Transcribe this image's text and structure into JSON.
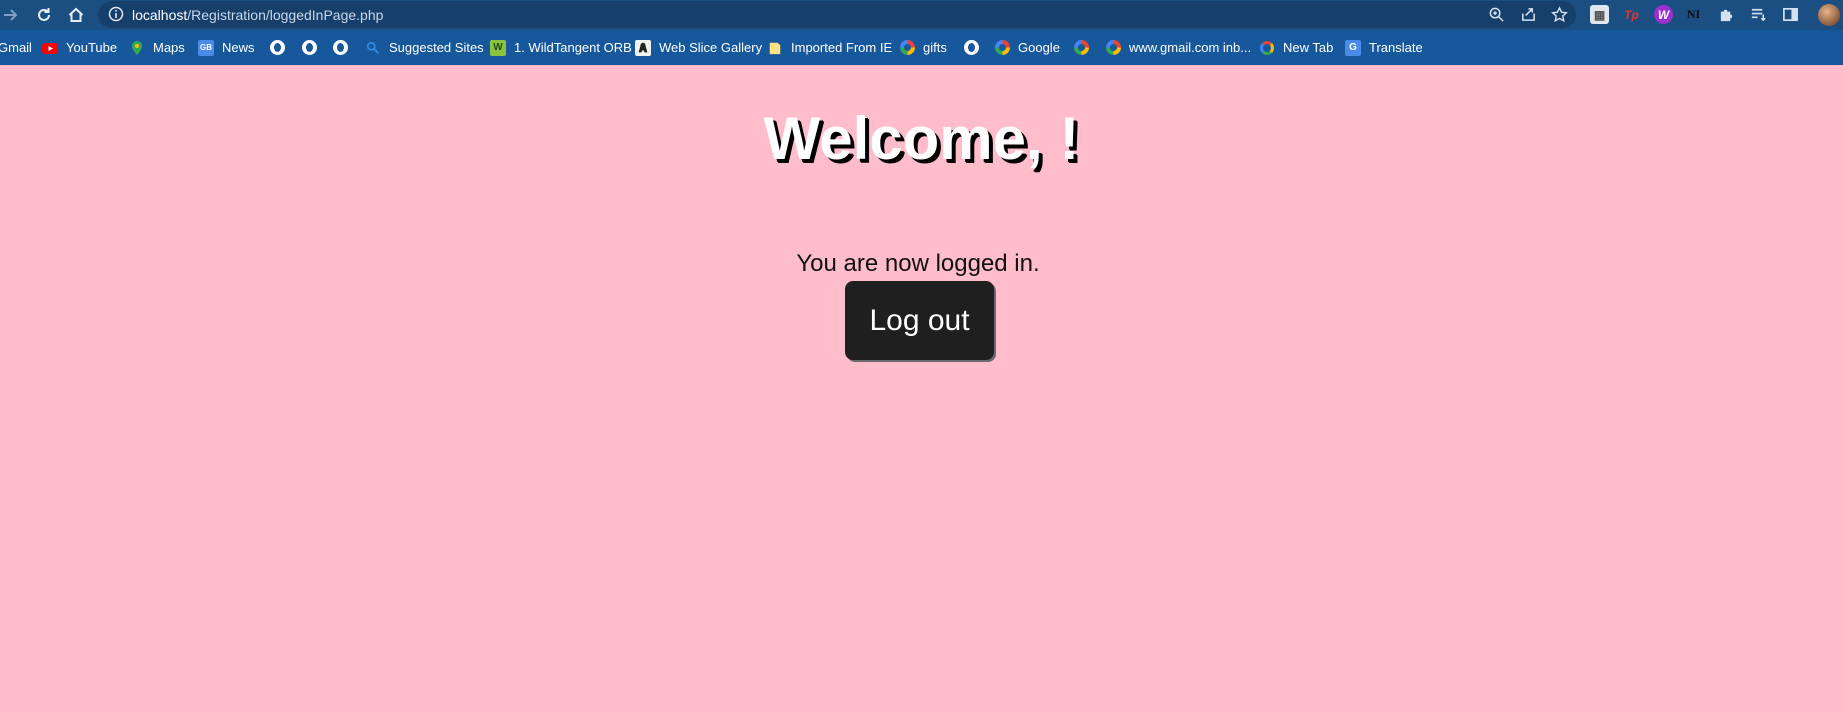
{
  "browser": {
    "address": {
      "host": "localhost",
      "path": "/Registration/loggedInPage.php"
    },
    "nav_icons": [
      "forward-icon",
      "reload-icon",
      "home-icon"
    ],
    "omnibox_icons": [
      "zoom-icon",
      "share-icon",
      "star-icon"
    ],
    "extension_icons": [
      "extension-generic-icon",
      "extension-tp-icon",
      "extension-w-icon",
      "extension-ni-icon",
      "puzzle-icon",
      "reading-list-icon",
      "side-panel-icon"
    ],
    "extension_labels": {
      "tp": "Tp",
      "w": "W",
      "ni": "NI"
    }
  },
  "bookmarks": [
    {
      "label": "Gmail",
      "icon": "gmail-icon"
    },
    {
      "label": "YouTube",
      "icon": "youtube-icon"
    },
    {
      "label": "Maps",
      "icon": "maps-icon"
    },
    {
      "label": "News",
      "icon": "news-icon"
    },
    {
      "label": "",
      "icon": "globe-icon"
    },
    {
      "label": "",
      "icon": "globe-icon"
    },
    {
      "label": "",
      "icon": "globe-icon"
    },
    {
      "label": "Suggested Sites",
      "icon": "search-icon"
    },
    {
      "label": "1. WildTangent ORB",
      "icon": "wildtangent-icon"
    },
    {
      "label": "Web Slice Gallery",
      "icon": "webslice-icon"
    },
    {
      "label": "Imported From IE",
      "icon": "folder-icon"
    },
    {
      "label": "gifts",
      "icon": "google-icon"
    },
    {
      "label": "",
      "icon": "globe-icon"
    },
    {
      "label": "Google",
      "icon": "google-icon"
    },
    {
      "label": "",
      "icon": "google-icon"
    },
    {
      "label": "www.gmail.com inb...",
      "icon": "google-icon"
    },
    {
      "label": "New Tab",
      "icon": "newtab-icon"
    },
    {
      "label": "Translate",
      "icon": "translate-icon"
    }
  ],
  "page": {
    "heading": "Welcome, !",
    "message": "You are now logged in.",
    "logout_label": "Log out"
  },
  "colors": {
    "page_background": "#ffbccb",
    "toolbar": "#1b4f82",
    "bookmarks_bar": "#17589c",
    "button": "#1f1f1f"
  }
}
